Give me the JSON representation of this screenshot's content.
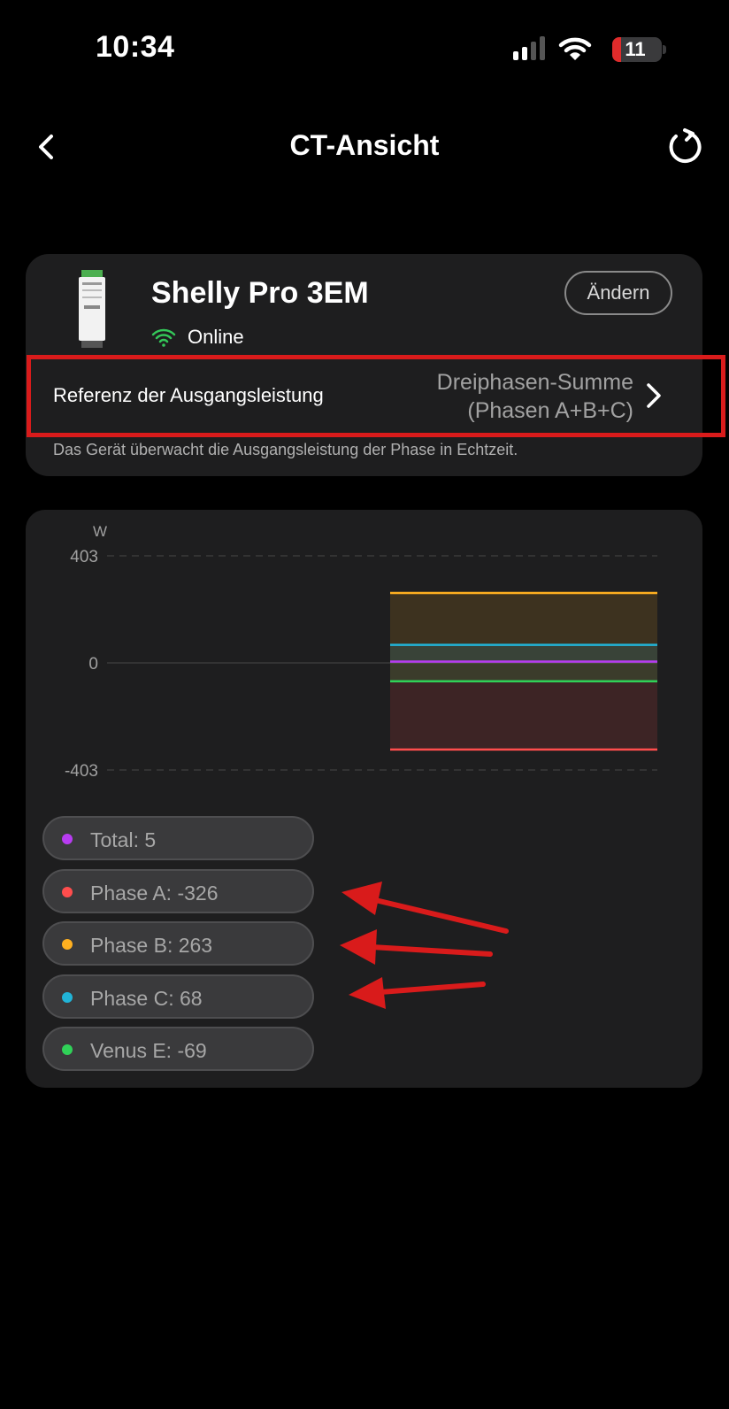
{
  "status_bar": {
    "time": "10:34",
    "battery_level": "11"
  },
  "nav": {
    "title": "CT-Ansicht",
    "back_icon": "chevron-left-icon",
    "refresh_icon": "refresh-icon"
  },
  "device": {
    "name": "Shelly Pro 3EM",
    "status": "Online",
    "change_label": "Ändern",
    "status_color": "#34c759"
  },
  "reference": {
    "label": "Referenz der Ausgangsleistung",
    "value_line1": "Dreiphasen-Summe",
    "value_line2": "(Phasen A+B+C)",
    "description": "Das Gerät überwacht die Ausgangsleistung der Phase in Echtzeit."
  },
  "chart_data": {
    "type": "area",
    "ylabel": "W",
    "ylim": [
      -403,
      403
    ],
    "yticks": [
      "403",
      "0",
      "-403"
    ],
    "grid": true,
    "legend_position": "bottom-left",
    "series": [
      {
        "name": "Total: 5",
        "value": 5,
        "color": "#b83cf2"
      },
      {
        "name": "Phase A: -326",
        "value": -326,
        "color": "#ff4d4d"
      },
      {
        "name": "Phase B: 263",
        "value": 263,
        "color": "#ffb020"
      },
      {
        "name": "Phase C: 68",
        "value": 68,
        "color": "#21b4d8"
      },
      {
        "name": "Venus E: -69",
        "value": -69,
        "color": "#30d158"
      }
    ]
  }
}
